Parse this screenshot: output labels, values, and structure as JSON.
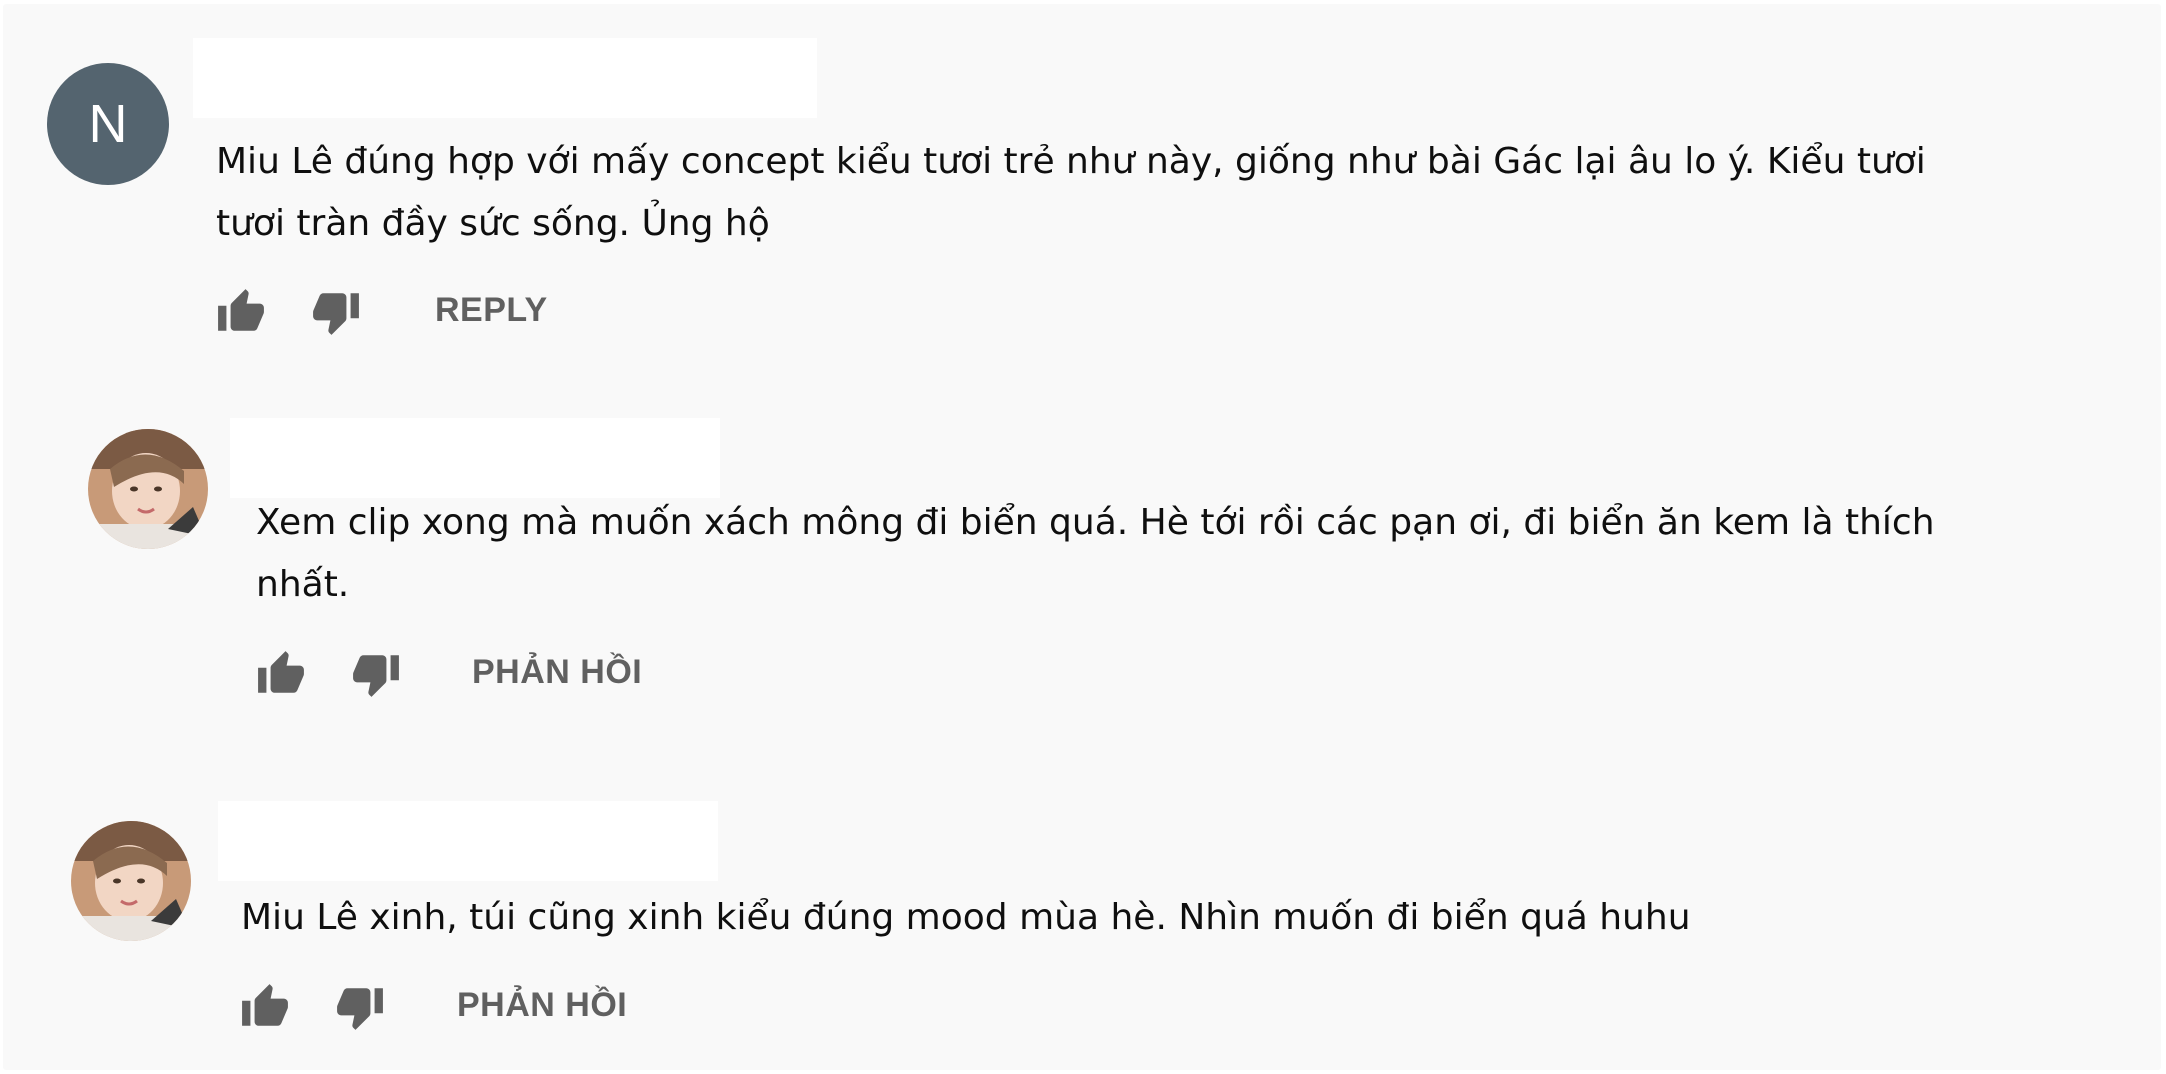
{
  "comments": [
    {
      "avatar_letter": "N",
      "line1": "Miu Lê đúng hợp với mấy concept kiểu tươi trẻ như này, giống như bài Gác lại âu lo ý. Kiểu tươi",
      "line2": "tươi tràn đầy sức sống. Ủng hộ",
      "reply_label": "REPLY"
    },
    {
      "line1": "Xem clip xong mà muốn xách mông đi biển quá. Hè tới rồi các pạn ơi, đi biển ăn kem là thích",
      "line2": "nhất.",
      "reply_label": "PHẢN HỒI"
    },
    {
      "line1": "Miu Lê xinh, túi cũng xinh kiểu đúng mood mùa hè. Nhìn muốn đi biển quá huhu",
      "reply_label": "PHẢN HỒI"
    }
  ],
  "colors": {
    "background": "#f9f9f9",
    "avatar_letter_bg": "#54646f",
    "text": "#0f0f0f",
    "icon": "#606060"
  },
  "icons": [
    "thumb-up-icon",
    "thumb-down-icon"
  ]
}
